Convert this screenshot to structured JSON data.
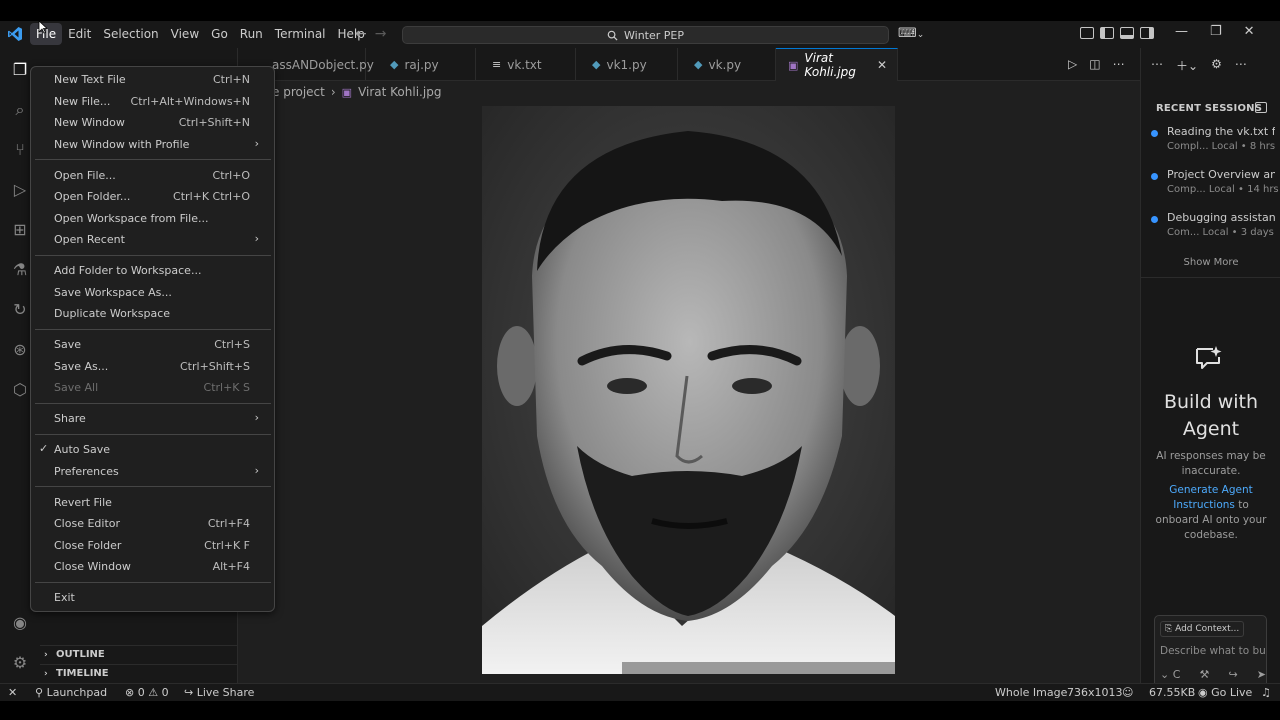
{
  "menubar": [
    "File",
    "Edit",
    "Selection",
    "View",
    "Go",
    "Run",
    "Terminal",
    "Help"
  ],
  "command_center": "Winter PEP",
  "tabs": [
    {
      "label": "assANDobject.py",
      "icon": "python-file-icon"
    },
    {
      "label": "raj.py",
      "icon": "python-file-icon"
    },
    {
      "label": "vk.txt",
      "icon": "text-file-icon"
    },
    {
      "label": "vk1.py",
      "icon": "python-file-icon"
    },
    {
      "label": "vk.py",
      "icon": "python-file-icon"
    },
    {
      "label": "Virat Kohli.jpg",
      "icon": "image-file-icon"
    }
  ],
  "breadcrumb": {
    "folder": "e project",
    "file": "Virat Kohli.jpg"
  },
  "sidebar": {
    "outline": "OUTLINE",
    "timeline": "TIMELINE"
  },
  "file_menu": {
    "groups": [
      [
        {
          "label": "New Text File",
          "shortcut": "Ctrl+N"
        },
        {
          "label": "New File...",
          "shortcut": "Ctrl+Alt+Windows+N"
        },
        {
          "label": "New Window",
          "shortcut": "Ctrl+Shift+N"
        },
        {
          "label": "New Window with Profile",
          "submenu": true
        }
      ],
      [
        {
          "label": "Open File...",
          "shortcut": "Ctrl+O"
        },
        {
          "label": "Open Folder...",
          "shortcut": "Ctrl+K Ctrl+O"
        },
        {
          "label": "Open Workspace from File..."
        },
        {
          "label": "Open Recent",
          "submenu": true
        }
      ],
      [
        {
          "label": "Add Folder to Workspace..."
        },
        {
          "label": "Save Workspace As..."
        },
        {
          "label": "Duplicate Workspace"
        }
      ],
      [
        {
          "label": "Save",
          "shortcut": "Ctrl+S"
        },
        {
          "label": "Save As...",
          "shortcut": "Ctrl+Shift+S"
        },
        {
          "label": "Save All",
          "shortcut": "Ctrl+K S",
          "disabled": true
        }
      ],
      [
        {
          "label": "Share",
          "submenu": true
        }
      ],
      [
        {
          "label": "Auto Save",
          "checked": true
        },
        {
          "label": "Preferences",
          "submenu": true
        }
      ],
      [
        {
          "label": "Revert File"
        },
        {
          "label": "Close Editor",
          "shortcut": "Ctrl+F4"
        },
        {
          "label": "Close Folder",
          "shortcut": "Ctrl+K F"
        },
        {
          "label": "Close Window",
          "shortcut": "Alt+F4"
        }
      ],
      [
        {
          "label": "Exit"
        }
      ]
    ]
  },
  "chat": {
    "recent_sessions_title": "RECENT SESSIONS",
    "sessions": [
      {
        "title": "Reading the vk.txt file",
        "meta": "Compl...  Local • 8 hrs"
      },
      {
        "title": "Project Overview an...",
        "meta": "Comp...  Local • 14 hrs"
      },
      {
        "title": "Debugging assistan...",
        "meta": "Com...  Local • 3 days"
      }
    ],
    "show_more": "Show More",
    "agent_title": "Build with Agent",
    "agent_note": "AI responses may be inaccurate.",
    "agent_link": "Generate Agent Instructions",
    "agent_link_suffix": "to onboard AI onto your codebase.",
    "add_context": "Add Context...",
    "input_placeholder": "Describe what to build",
    "mode_label": "C"
  },
  "statusbar": {
    "launchpad": "Launchpad",
    "errors": "0",
    "warnings": "0",
    "liveshare": "Live Share",
    "image_view": "Whole Image",
    "dimensions": "736x1013",
    "filesize": "67.55KB",
    "golive": "Go Live"
  },
  "colors": {
    "accent": "#0078d4",
    "link": "#4daafc",
    "session_dot": "#3794ff"
  }
}
